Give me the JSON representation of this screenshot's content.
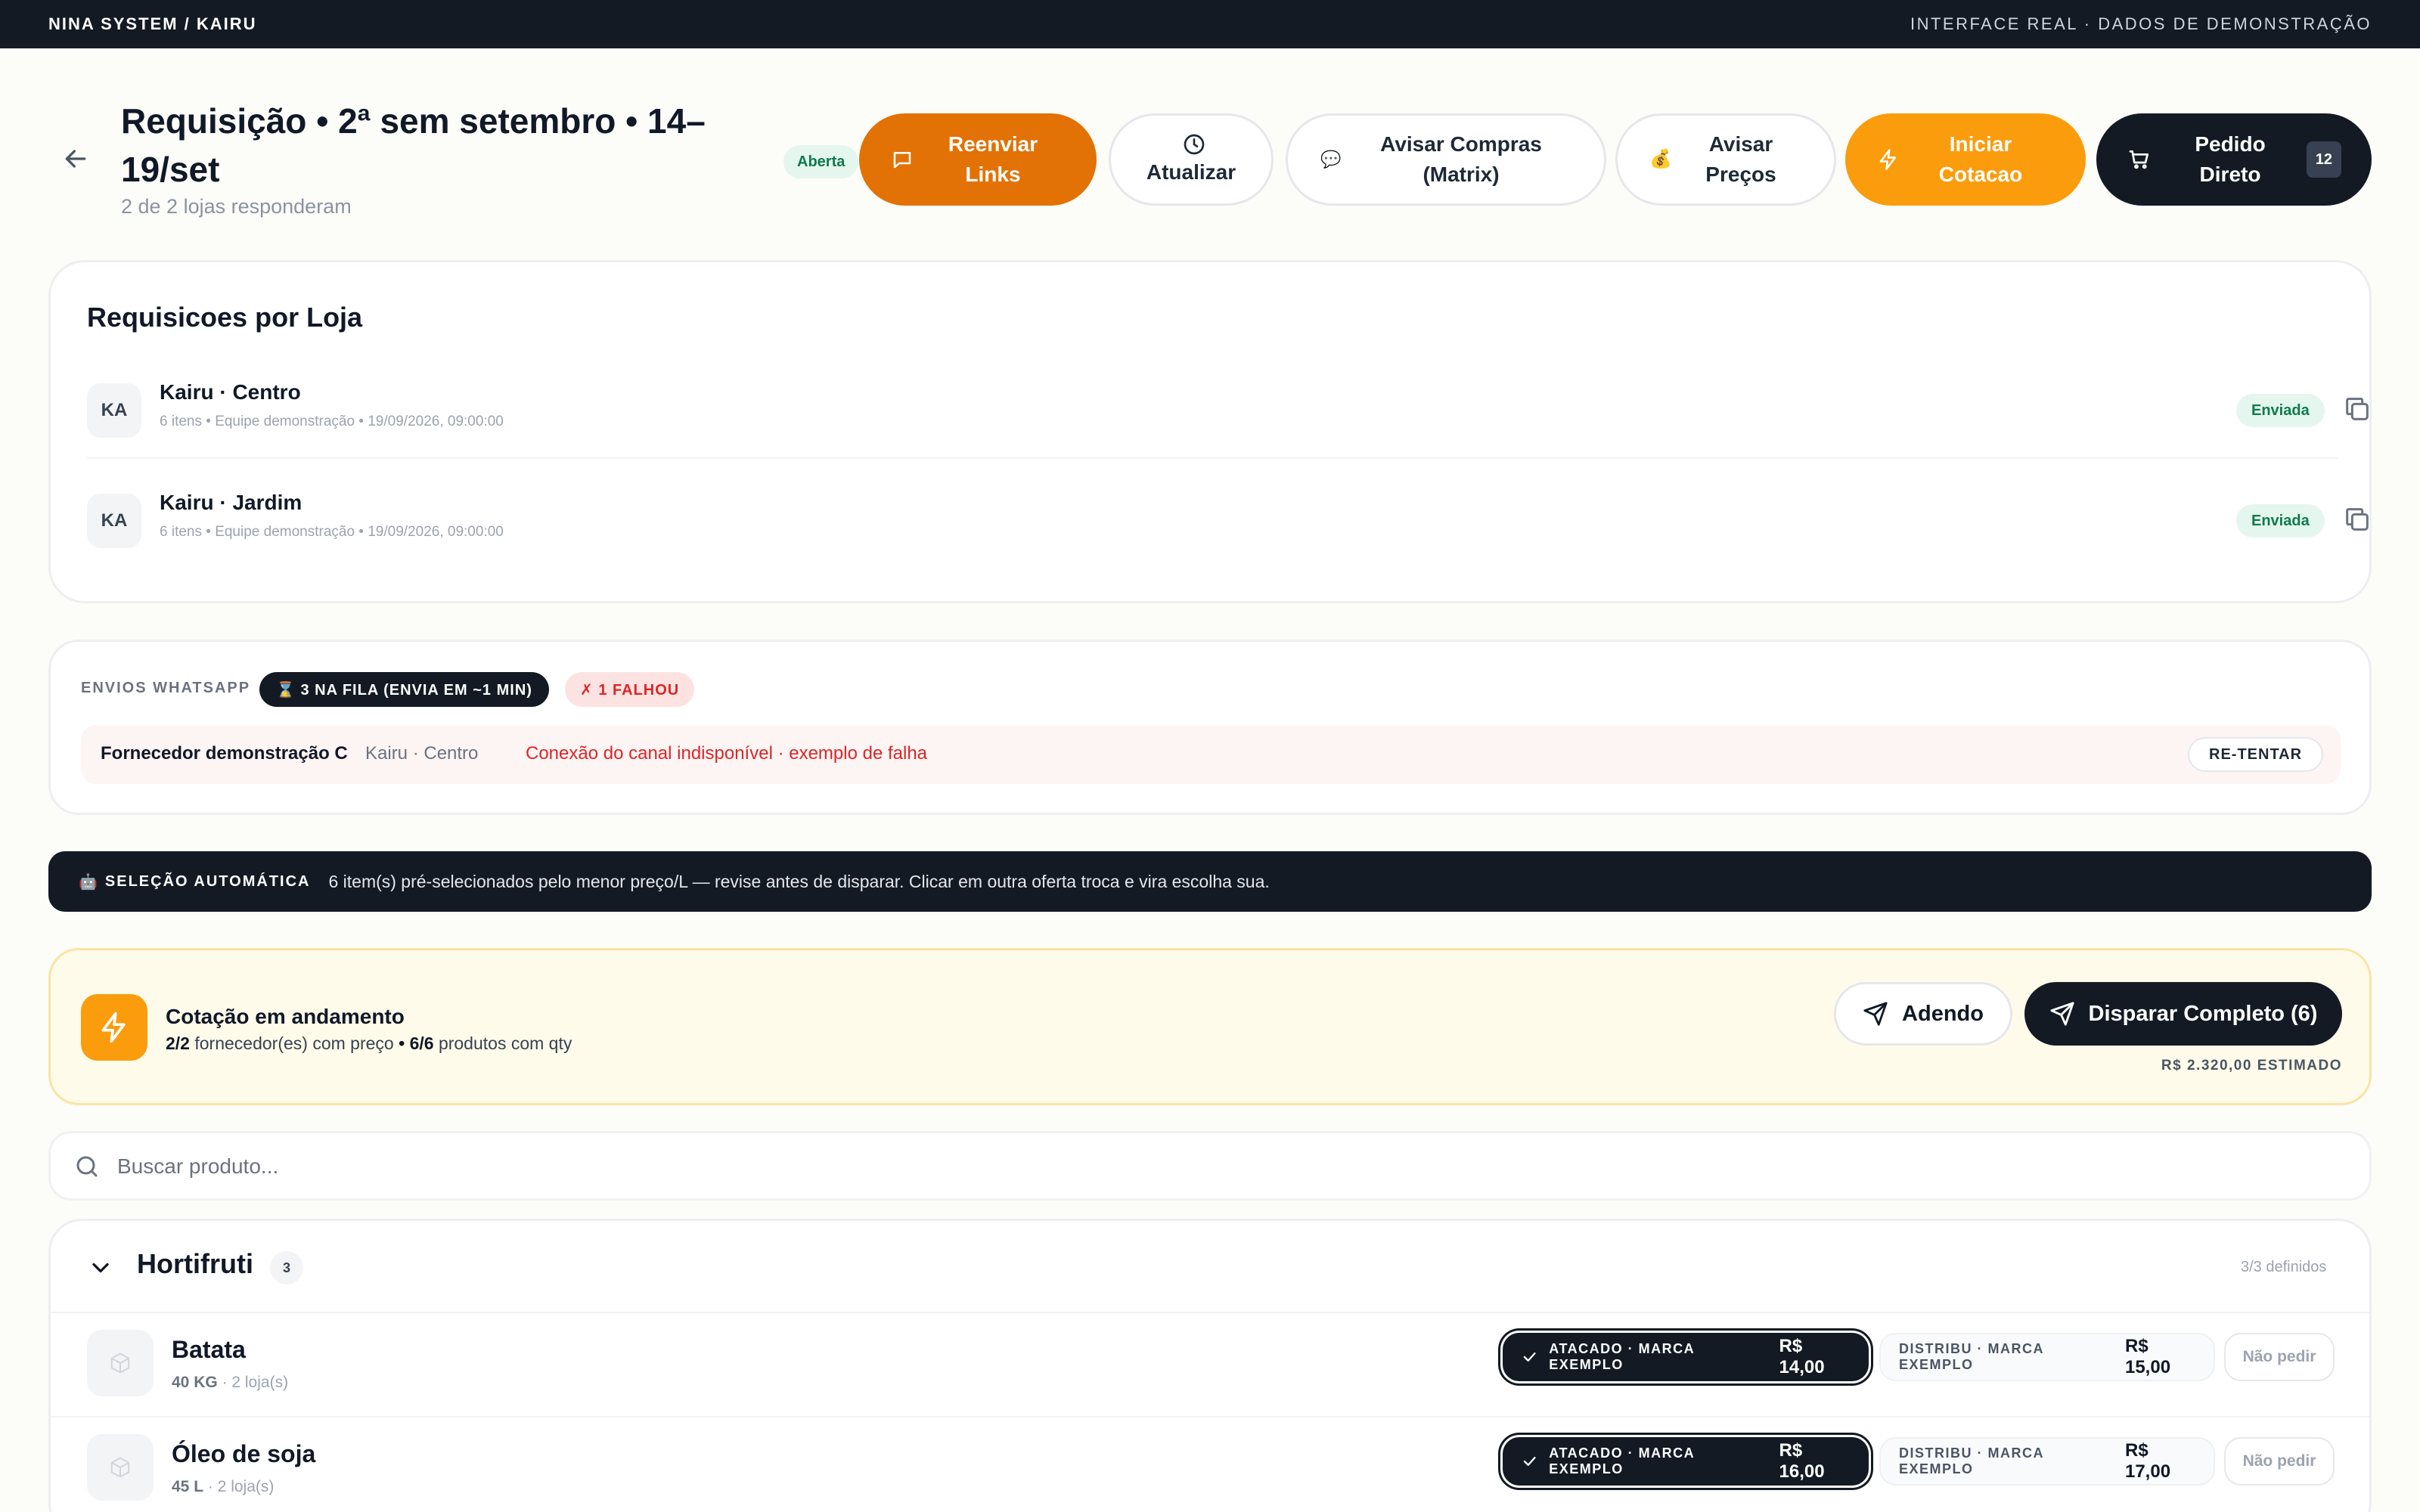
{
  "topbar": {
    "left": "NINA SYSTEM / KAIRU",
    "right": "INTERFACE REAL · DADOS DE DEMONSTRAÇÃO"
  },
  "header": {
    "title": "Requisição • 2ª sem setembro • 14–19/set",
    "subtitle": "2 de 2 lojas responderam",
    "status": "Aberta",
    "buttons": {
      "resend": "Reenviar Links",
      "refresh": "Atualizar",
      "notify_purchases": "Avisar Compras (Matrix)",
      "notify_prices": "Avisar Preços",
      "start_quote": "Iniciar Cotacao",
      "direct_order": "Pedido Direto",
      "direct_order_count": "12"
    }
  },
  "requests": {
    "title": "Requisicoes por Loja",
    "stores": [
      {
        "initials": "KA",
        "name": "Kairu · Centro",
        "meta": "6 itens • Equipe demonstração • 19/09/2026, 09:00:00",
        "status": "Enviada"
      },
      {
        "initials": "KA",
        "name": "Kairu · Jardim",
        "meta": "6 itens • Equipe demonstração • 19/09/2026, 09:00:00",
        "status": "Enviada"
      }
    ]
  },
  "whatsapp": {
    "label": "ENVIOS WHATSAPP",
    "queue": "⌛ 3 NA FILA (ENVIA EM ~1 MIN)",
    "failed": "✗ 1 FALHOU",
    "failure": {
      "supplier": "Fornecedor demonstração C",
      "store": "Kairu · Centro",
      "error": "Conexão do canal indisponível · exemplo de falha",
      "retry": "RE-TENTAR"
    }
  },
  "auto_selection": {
    "icon": "🤖",
    "title": "SELEÇÃO AUTOMÁTICA",
    "text": "6 item(s) pré-selecionados pelo menor preço/L — revise antes de disparar. Clicar em outra oferta troca e vira escolha sua."
  },
  "quote": {
    "title": "Cotação em andamento",
    "suppliers_count": "2/2",
    "suppliers_text": "fornecedor(es) com preço",
    "separator": "•",
    "products_count": "6/6",
    "products_text": "produtos com qty",
    "addendum": "Adendo",
    "dispatch": "Disparar Completo (6)",
    "estimate": "R$ 2.320,00 ESTIMADO"
  },
  "search": {
    "placeholder": "Buscar produto..."
  },
  "category": {
    "name": "Hortifruti",
    "count": "3",
    "defined": "3/3 definidos",
    "products": [
      {
        "name": "Batata",
        "qty": "40 KG",
        "stores": "2 loja(s)",
        "selected_offer": {
          "source": "ATACADO · MARCA EXEMPLO",
          "price": "R$ 14,00"
        },
        "alt_offer": {
          "source": "DISTRIBU · MARCA EXEMPLO",
          "price": "R$ 15,00"
        },
        "skip": "Não pedir"
      },
      {
        "name": "Óleo de soja",
        "qty": "45 L",
        "stores": "2 loja(s)",
        "selected_offer": {
          "source": "ATACADO · MARCA EXEMPLO",
          "price": "R$ 16,00"
        },
        "alt_offer": {
          "source": "DISTRIBU · MARCA EXEMPLO",
          "price": "R$ 17,00"
        },
        "skip": "Não pedir"
      }
    ]
  },
  "colors": {
    "navy": "#141a24",
    "orange": "#fb9c0c",
    "orange_dark": "#e27205",
    "green": "#0f7a4f",
    "red": "#dc2626",
    "quote_bg": "#fefbea"
  }
}
